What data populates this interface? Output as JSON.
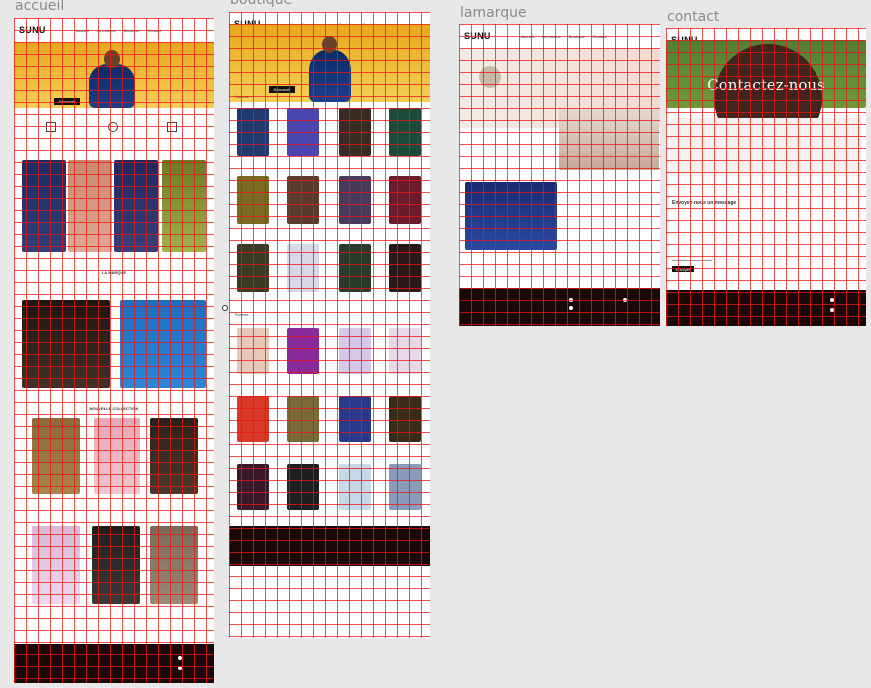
{
  "frames": {
    "accueil": {
      "label": "accueil",
      "cta": "Découvrir",
      "section_brand": "LA MARQUE",
      "section_collection": "NOUVELLE COLLECTION"
    },
    "boutique": {
      "label": "boutique",
      "cta": "Découvrir",
      "section_homme": "Homme",
      "section_femme": "Femme"
    },
    "lamarque": {
      "label": "lamarque"
    },
    "contact": {
      "label": "contact",
      "hero_title": "Contactez-nous",
      "form_title": "Envoyez-nous un message",
      "send_label": "Envoyer"
    }
  },
  "nav": {
    "logo": "SUNU",
    "items": [
      "Accueil",
      "La marque",
      "Boutique",
      "Contact"
    ]
  },
  "colors": {
    "hero_top": "#e9a81c",
    "hero_bottom": "#f5cf56",
    "footer": "#1a0707",
    "grid": "#eb1414",
    "navy": "#0d2a66"
  }
}
